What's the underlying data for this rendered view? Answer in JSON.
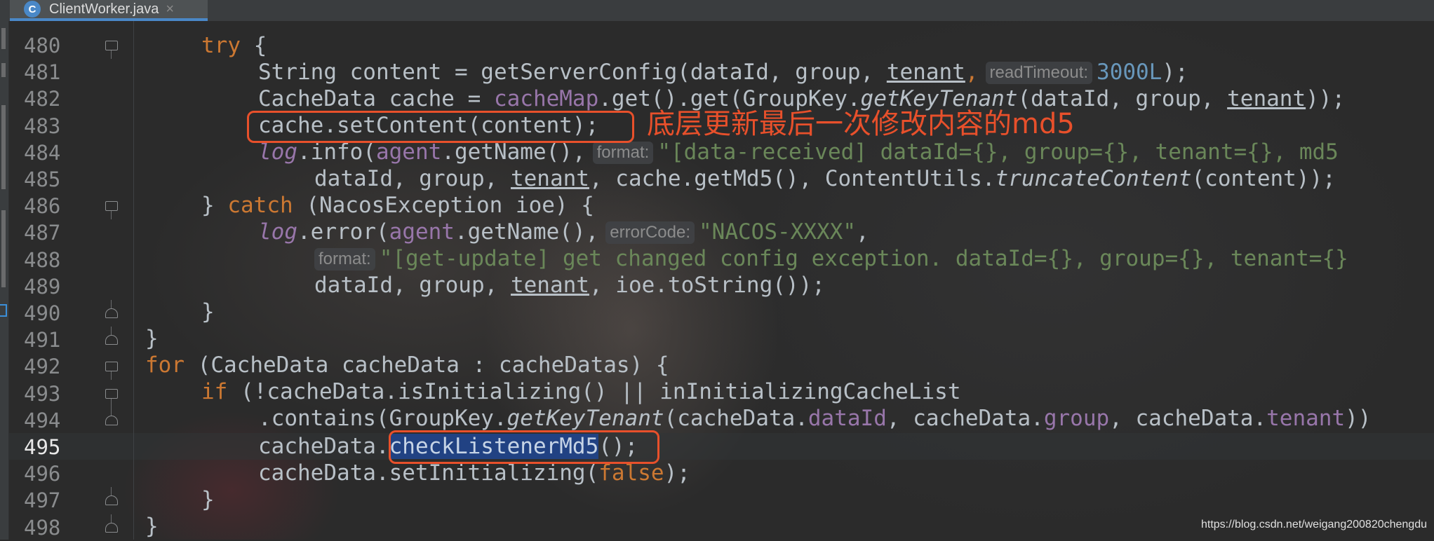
{
  "tab": {
    "icon_letter": "C",
    "label": "ClientWorker.java",
    "close": "×"
  },
  "editor": {
    "current_line": "495",
    "lines": [
      {
        "num": "480",
        "fold": "start"
      },
      {
        "num": "481",
        "fold": ""
      },
      {
        "num": "482",
        "fold": ""
      },
      {
        "num": "483",
        "fold": ""
      },
      {
        "num": "484",
        "fold": ""
      },
      {
        "num": "485",
        "fold": ""
      },
      {
        "num": "486",
        "fold": "start"
      },
      {
        "num": "487",
        "fold": ""
      },
      {
        "num": "488",
        "fold": ""
      },
      {
        "num": "489",
        "fold": ""
      },
      {
        "num": "490",
        "fold": "end"
      },
      {
        "num": "491",
        "fold": "end"
      },
      {
        "num": "492",
        "fold": "start"
      },
      {
        "num": "493",
        "fold": "start"
      },
      {
        "num": "494",
        "fold": "end"
      },
      {
        "num": "495",
        "fold": ""
      },
      {
        "num": "496",
        "fold": ""
      },
      {
        "num": "497",
        "fold": "end"
      },
      {
        "num": "498",
        "fold": "end"
      }
    ],
    "code": {
      "l480": {
        "try": "try",
        "rest": " {"
      },
      "l481": {
        "a": "String content = getServerConfig(dataId, group, ",
        "tenant": "tenant",
        "comma": ",",
        "hint": "readTimeout:",
        "num": "3000L",
        "end": ");"
      },
      "l482": {
        "a": "CacheData cache = ",
        "field": "cacheMap",
        "b": ".get().get(GroupKey.",
        "call": "getKeyTenant",
        "c": "(dataId, group, ",
        "tenant": "tenant",
        "end": "));"
      },
      "l483": {
        "a": "cache.setContent(content);"
      },
      "l484": {
        "log": "log",
        "a": ".info(",
        "agent": "agent",
        "b": ".getName(),",
        "hint": "format:",
        "str": "\"[data-received] dataId={}, group={}, tenant={}, md5"
      },
      "l485": {
        "a": "dataId, group, ",
        "tenant": "tenant",
        "b": ", cache.getMd5(), ContentUtils.",
        "call": "truncateContent",
        "end": "(content));"
      },
      "l486": {
        "a": "} ",
        "catch": "catch",
        "b": " (NacosException ioe) {"
      },
      "l487": {
        "log": "log",
        "a": ".error(",
        "agent": "agent",
        "b": ".getName(),",
        "hint": "errorCode:",
        "str": "\"NACOS-XXXX\"",
        "end": ","
      },
      "l488": {
        "hint": "format:",
        "str": "\"[get-update] get changed config exception. dataId={}, group={}, tenant={}"
      },
      "l489": {
        "a": "dataId, group, ",
        "tenant": "tenant",
        "b": ", ioe.toString());"
      },
      "l490": {
        "a": "}"
      },
      "l491": {
        "a": "}"
      },
      "l492": {
        "for": "for",
        "a": " (CacheData cacheData : cacheDatas) {"
      },
      "l493": {
        "if": "if",
        "a": " (!cacheData.isInitializing() || inInitializingCacheList"
      },
      "l494": {
        "a": ".contains(GroupKey.",
        "call": "getKeyTenant",
        "b": "(cacheData.",
        "f1": "dataId",
        "c": ", cacheData.",
        "f2": "group",
        "d": ", cacheData.",
        "f3": "tenant",
        "end": "))"
      },
      "l495": {
        "a": "cacheData.",
        "sel": "checkListenerMd5",
        "end": "();"
      },
      "l496": {
        "a": "cacheData.setInitializing(",
        "false": "false",
        "end": ");"
      },
      "l497": {
        "a": "}"
      },
      "l498": {
        "a": "}"
      }
    }
  },
  "annotation": {
    "text": "底层更新最后一次修改内容的md5",
    "color": "#e8502b"
  },
  "watermark": "https://blog.csdn.net/weigang200820chengdu",
  "colors": {
    "keyword": "#cc7832",
    "string": "#6a8759",
    "number": "#6897bb",
    "field": "#9876aa",
    "selection": "#214283",
    "tab_underline": "#4a88c7"
  }
}
